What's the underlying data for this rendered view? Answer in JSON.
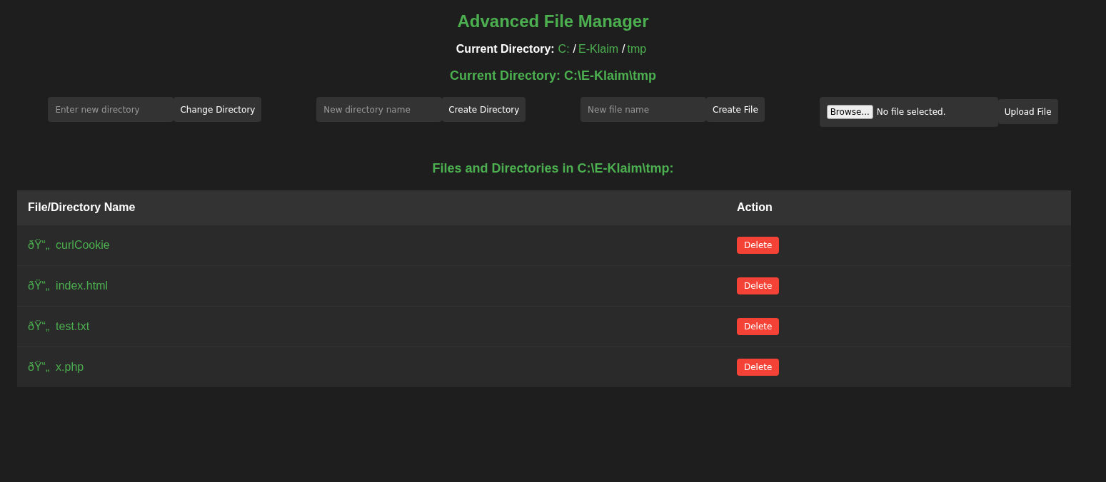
{
  "title": "Advanced File Manager",
  "breadcrumb": {
    "label": "Current Directory:",
    "separator": "/",
    "segments": [
      "C:",
      "E-Klaim",
      "tmp"
    ]
  },
  "current_directory": "Current Directory: C:\\E-Klaim\\tmp",
  "forms": [
    {
      "kind": "text",
      "placeholder": "Enter new directory",
      "button": "Change Directory"
    },
    {
      "kind": "text",
      "placeholder": "New directory name",
      "button": "Create Directory"
    },
    {
      "kind": "text",
      "placeholder": "New file name",
      "button": "Create File"
    },
    {
      "kind": "file",
      "browse": "Browse...",
      "status": "No file selected.",
      "button": "Upload File"
    }
  ],
  "listing_title": "Files and Directories in C:\\E-Klaim\\tmp:",
  "table": {
    "columns": [
      "File/Directory Name",
      "Action"
    ],
    "rows": [
      {
        "name": "ðŸ“„  curlCookie",
        "action": "Delete"
      },
      {
        "name": "ðŸ“„  index.html",
        "action": "Delete"
      },
      {
        "name": "ðŸ“„  test.txt",
        "action": "Delete"
      },
      {
        "name": "ðŸ“„  x.php",
        "action": "Delete"
      }
    ]
  }
}
